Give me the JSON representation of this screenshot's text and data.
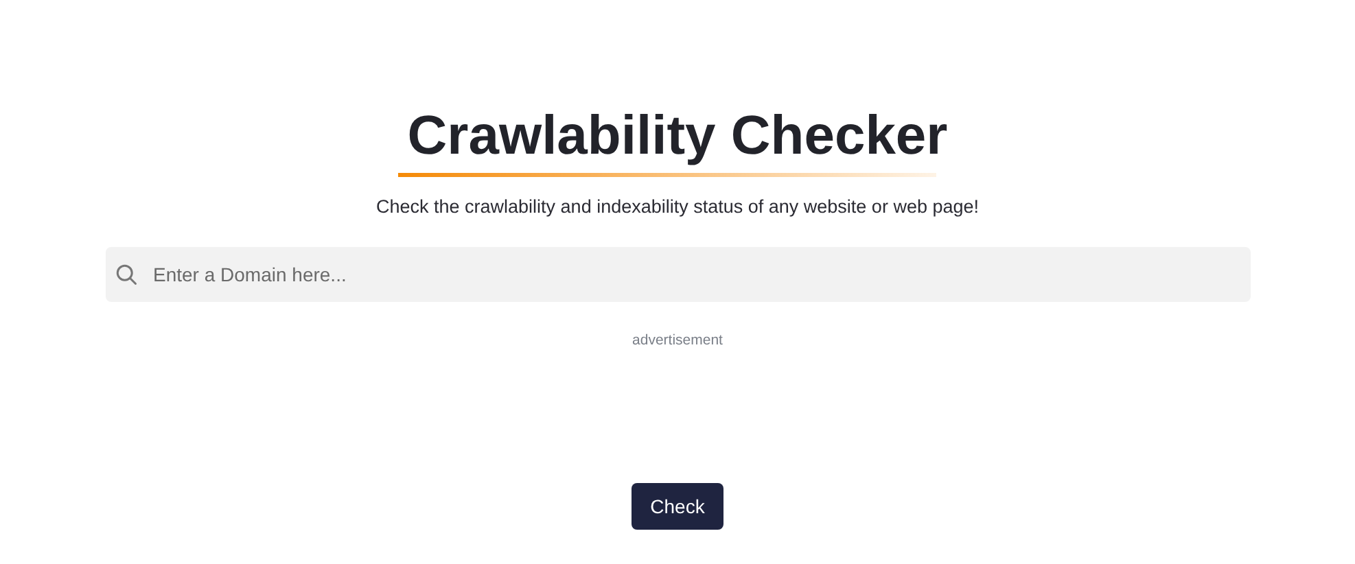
{
  "title": "Crawlability Checker",
  "subtitle": "Check the crawlability and indexability status of any website or web page!",
  "search": {
    "placeholder": "Enter a Domain here..."
  },
  "ad_label": "advertisement",
  "buttons": [
    "Check"
  ]
}
